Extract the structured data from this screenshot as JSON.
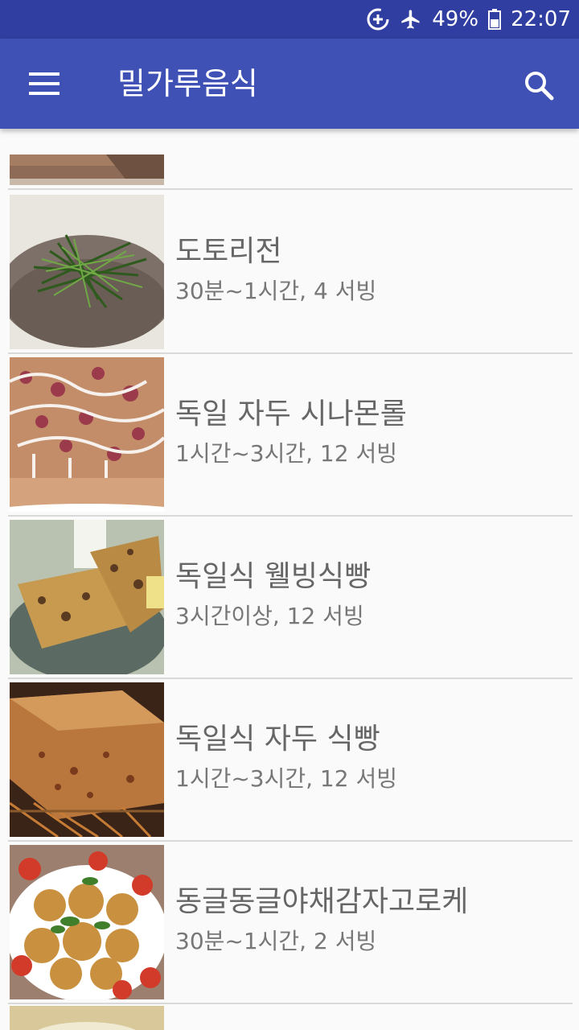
{
  "status_bar": {
    "battery_percent": "49%",
    "time": "22:07"
  },
  "app_bar": {
    "title": "밀가루음식"
  },
  "recipes": [
    {
      "title": "도토리전",
      "subtitle": "30분~1시간, 4 서빙"
    },
    {
      "title": "독일 자두 시나몬롤",
      "subtitle": "1시간~3시간, 12 서빙"
    },
    {
      "title": "독일식 웰빙식빵",
      "subtitle": "3시간이상, 12 서빙"
    },
    {
      "title": "독일식 자두 식빵",
      "subtitle": "1시간~3시간, 12 서빙"
    },
    {
      "title": "동글동글야채감자고로케",
      "subtitle": "30분~1시간, 2 서빙"
    }
  ]
}
